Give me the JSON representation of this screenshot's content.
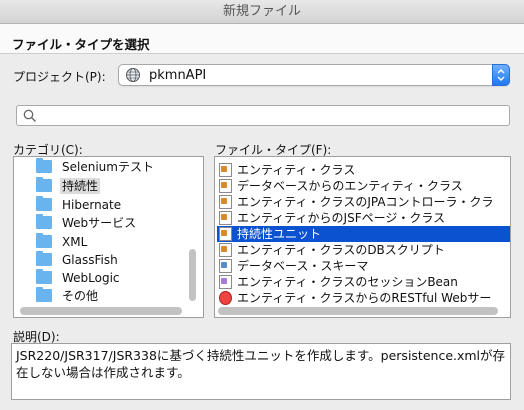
{
  "window": {
    "title": "新規ファイル"
  },
  "header": {
    "title": "ファイル・タイプを選択"
  },
  "project": {
    "label": "プロジェクト(P):",
    "value": "pkmnAPI"
  },
  "search": {
    "placeholder": "",
    "value": ""
  },
  "categories": {
    "label": "カテゴリ(C):",
    "items": [
      {
        "label": "Seleniumテスト"
      },
      {
        "label": "持続性"
      },
      {
        "label": "Hibernate"
      },
      {
        "label": "Webサービス"
      },
      {
        "label": "XML"
      },
      {
        "label": "GlassFish"
      },
      {
        "label": "WebLogic"
      },
      {
        "label": "その他"
      }
    ],
    "highlighted_index": 1
  },
  "file_types": {
    "label": "ファイル・タイプ(F):",
    "items": [
      {
        "label": "エンティティ・クラス",
        "icon": "entity-class-icon"
      },
      {
        "label": "データベースからのエンティティ・クラス",
        "icon": "entity-from-db-icon"
      },
      {
        "label": "エンティティ・クラスのJPAコントローラ・クラ",
        "icon": "jpa-controller-icon"
      },
      {
        "label": "エンティティからのJSFページ・クラス",
        "icon": "jsf-page-icon"
      },
      {
        "label": "持続性ユニット",
        "icon": "persistence-unit-icon"
      },
      {
        "label": "エンティティ・クラスのDBスクリプト",
        "icon": "db-script-icon"
      },
      {
        "label": "データベース・スキーマ",
        "icon": "db-schema-icon"
      },
      {
        "label": "エンティティ・クラスのセッションBean",
        "icon": "session-bean-icon"
      },
      {
        "label": "エンティティ・クラスからのRESTful Webサー",
        "icon": "restful-icon"
      }
    ],
    "selected_index": 4
  },
  "description": {
    "label": "説明(D):",
    "text": "JSR220/JSR317/JSR338に基づく持続性ユニットを作成します。persistence.xmlが存在しない場合は作成されます。"
  },
  "colors": {
    "selection": "#0b52d1",
    "folder": "#69b4ee",
    "stepper": "#1f78f0"
  }
}
